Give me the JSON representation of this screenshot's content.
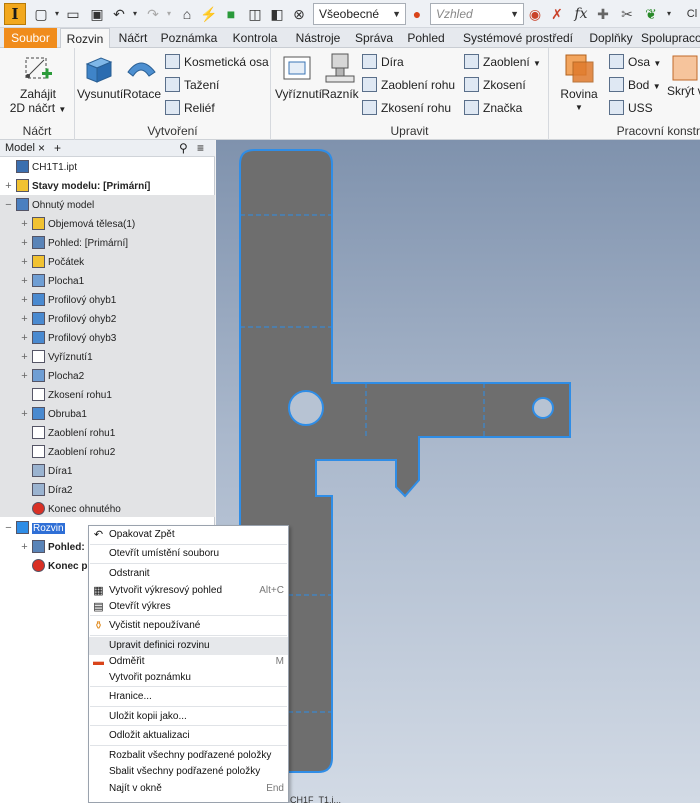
{
  "qat": {
    "logo": "I",
    "appearance_combo": "Všeobecné",
    "style_combo": "Vzhled",
    "right_text": "Cl"
  },
  "tabs": [
    "Soubor",
    "Rozvin",
    "Náčrt",
    "Poznámka",
    "Kontrola",
    "Nástroje",
    "Správa",
    "Pohled",
    "Systémové prostředí",
    "Doplňky",
    "Spolupraco"
  ],
  "ribbon": {
    "nacrt": {
      "title": "Náčrt",
      "start_line1": "Zahájit",
      "start_line2": "2D náčrt"
    },
    "vytvoreni": {
      "title": "Vytvoření",
      "vysunuti": "Vysunutí",
      "rotace": "Rotace",
      "kosmeticka": "Kosmetická osa",
      "tazeni": "Tažení",
      "relief": "Reliéf"
    },
    "upravit": {
      "title": "Upravit",
      "vyriznuti": "Vyříznutí",
      "raznik": "Razník",
      "dira": "Díra",
      "zaobleni_rohu": "Zaoblení rohu",
      "zkoseni_rohu": "Zkosení rohu",
      "zaobleni": "Zaoblení",
      "zkoseni": "Zkosení",
      "znacka": "Značka"
    },
    "pracovni": {
      "title": "Pracovní konstr",
      "rovina": "Rovina",
      "osa": "Osa",
      "bod": "Bod",
      "uss": "USS",
      "skryt": "Skrýt v"
    }
  },
  "browser": {
    "tab_label": "Model",
    "close": "×",
    "add": "+",
    "nodes": [
      {
        "label": "CH1T1.ipt",
        "bold": false
      },
      {
        "label": "Stavy modelu: [Primární]",
        "bold": true
      },
      {
        "label": "Ohnutý model",
        "bold": false
      },
      {
        "label": "Objemová tělesa(1)",
        "bold": false
      },
      {
        "label": "Pohled: [Primární]",
        "bold": false
      },
      {
        "label": "Počátek",
        "bold": false
      },
      {
        "label": "Plocha1",
        "bold": false
      },
      {
        "label": "Profilový ohyb1",
        "bold": false
      },
      {
        "label": "Profilový ohyb2",
        "bold": false
      },
      {
        "label": "Profilový ohyb3",
        "bold": false
      },
      {
        "label": "Vyříznutí1",
        "bold": false
      },
      {
        "label": "Plocha2",
        "bold": false
      },
      {
        "label": "Zkosení rohu1",
        "bold": false
      },
      {
        "label": "Obruba1",
        "bold": false
      },
      {
        "label": "Zaoblení rohu1",
        "bold": false
      },
      {
        "label": "Zaoblení rohu2",
        "bold": false
      },
      {
        "label": "Díra1",
        "bold": false
      },
      {
        "label": "Díra2",
        "bold": false
      },
      {
        "label": "Konec ohnutého",
        "bold": false
      },
      {
        "label": "Rozvin",
        "bold": false
      },
      {
        "label": "Pohled:",
        "bold": true
      },
      {
        "label": "Konec p",
        "bold": true
      }
    ]
  },
  "context_menu": {
    "items": [
      {
        "label": "Opakovat Zpět",
        "shortcut": ""
      },
      {
        "label": "Otevřít umístění souboru",
        "shortcut": ""
      },
      {
        "label": "Odstranit",
        "shortcut": ""
      },
      {
        "label": "Vytvořit výkresový pohled",
        "shortcut": "Alt+C"
      },
      {
        "label": "Otevřít výkres",
        "shortcut": ""
      },
      {
        "label": "Vyčistit nepoužívané",
        "shortcut": ""
      },
      {
        "label": "Upravit definici rozvinu",
        "shortcut": ""
      },
      {
        "label": "Odměřit",
        "shortcut": "M"
      },
      {
        "label": "Vytvořit poznámku",
        "shortcut": ""
      },
      {
        "label": "Hranice...",
        "shortcut": ""
      },
      {
        "label": "Uložit kopii jako...",
        "shortcut": ""
      },
      {
        "label": "Odložit aktualizaci",
        "shortcut": ""
      },
      {
        "label": "Rozbalit všechny podřazené položky",
        "shortcut": ""
      },
      {
        "label": "Sbalit všechny podřazené položky",
        "shortcut": ""
      },
      {
        "label": "Najít v okně",
        "shortcut": "End"
      }
    ]
  },
  "bottom_tab": "CH1F_T1.i..."
}
